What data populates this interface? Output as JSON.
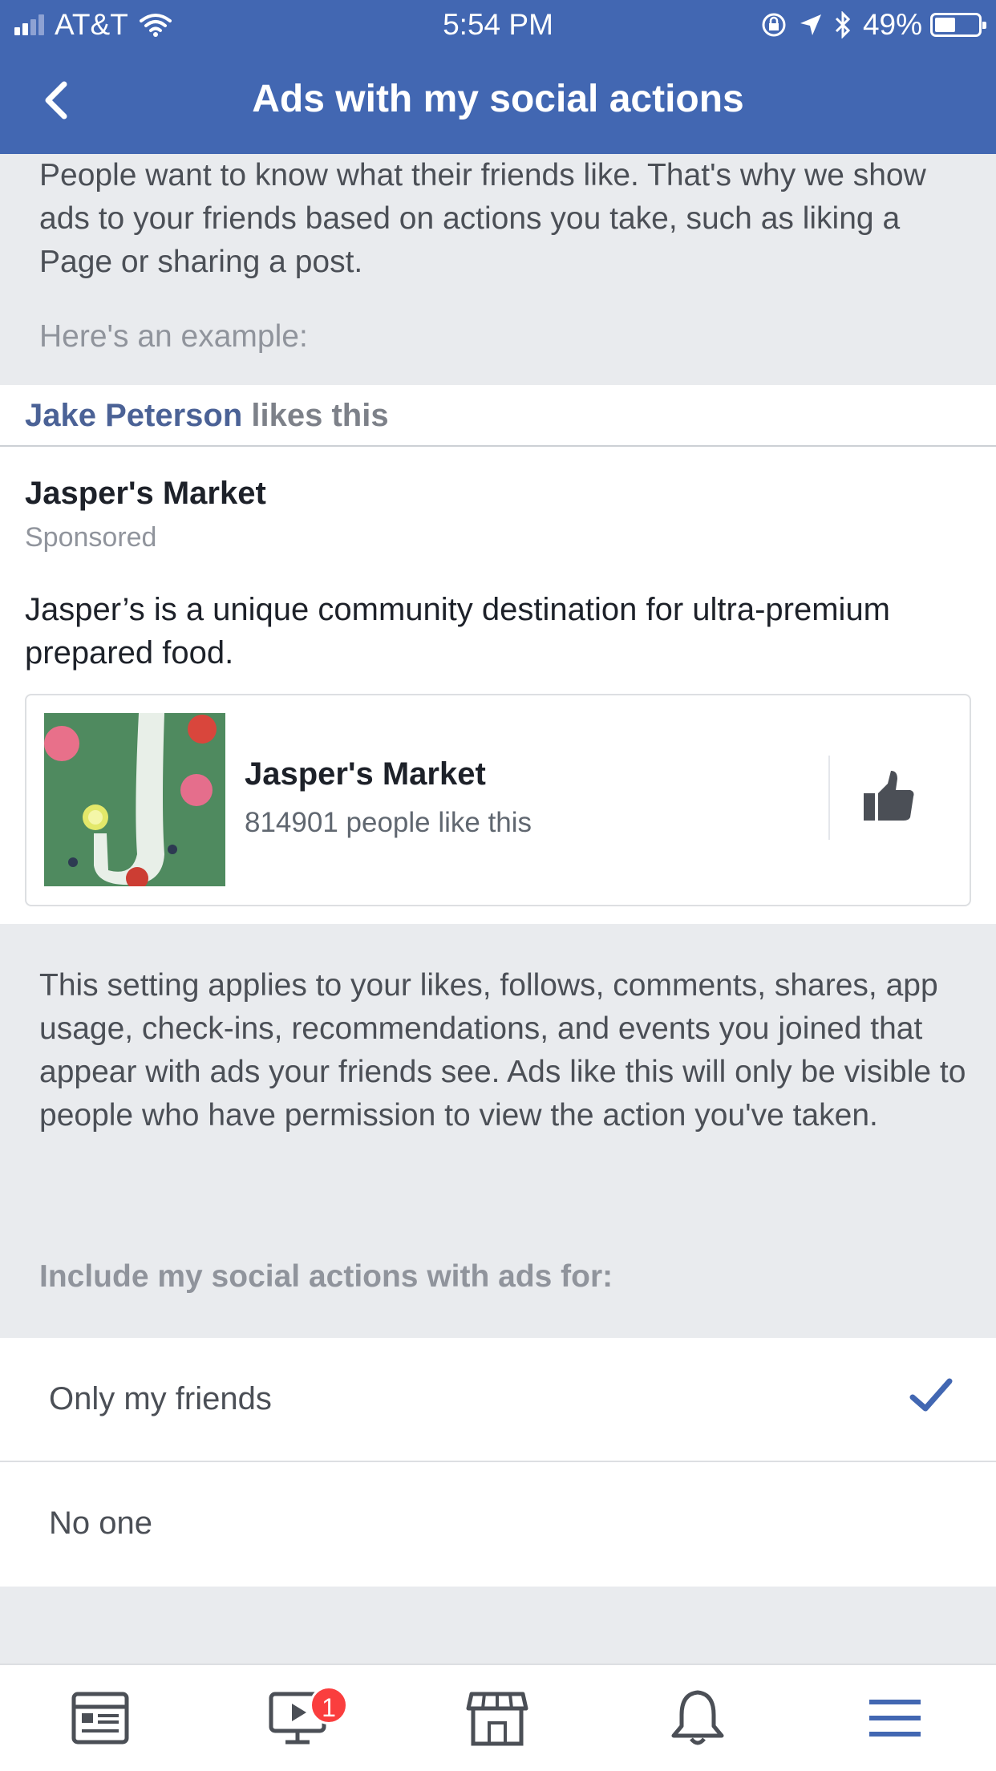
{
  "status_bar": {
    "carrier": "AT&T",
    "time": "5:54 PM",
    "battery": "49%",
    "battery_level": 0.49
  },
  "nav": {
    "title": "Ads with my social actions",
    "back_icon": "chevron-left-icon"
  },
  "intro": {
    "text": "People want to know what their friends like. That's why we show ads to your friends based on actions you take, such as liking a Page or sharing a post.",
    "example_label": "Here's an example:"
  },
  "example_ad": {
    "social_context": {
      "friend": "Jake Peterson",
      "action": " likes this"
    },
    "page_name": "Jasper's Market",
    "sponsored": "Sponsored",
    "body": "Jasper’s is a unique community destination for ultra-premium prepared food.",
    "card": {
      "title": "Jasper's Market",
      "likes": "814901 people like this",
      "like_icon": "thumbs-up-icon"
    }
  },
  "setting": {
    "description": "This setting applies to your likes, follows, comments, shares, app usage, check-ins, recommendations, and events you joined that appear with ads your friends see. Ads like this will only be visible to people who have permission to view the action you've taken.",
    "label": "Include my social actions with ads for:"
  },
  "options": [
    {
      "label": "Only my friends",
      "selected": true
    },
    {
      "label": "No one",
      "selected": false
    }
  ],
  "tab_bar": {
    "tabs": [
      "news-feed-icon",
      "watch-icon",
      "marketplace-icon",
      "notifications-icon",
      "menu-icon"
    ],
    "watch_badge": "1",
    "active_color": "#4267b2"
  }
}
